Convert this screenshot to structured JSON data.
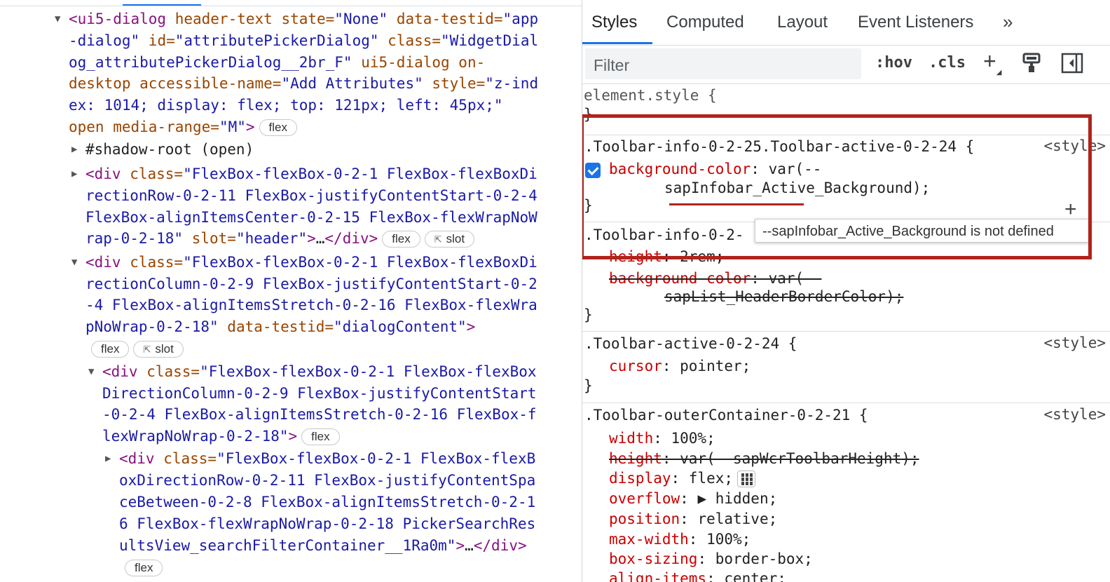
{
  "elements": {
    "lines": [
      {
        "segs": [
          [
            "tag",
            "<ui5-dialog "
          ],
          [
            "an",
            "header-text "
          ],
          [
            "an",
            "state="
          ],
          [
            "av",
            "\"None\" "
          ],
          [
            "an",
            "data-testid="
          ],
          [
            "av",
            "\"app"
          ]
        ]
      },
      {
        "segs": [
          [
            "av",
            "-dialog\" "
          ],
          [
            "an",
            "id="
          ],
          [
            "av",
            "\"attributePickerDialog\" "
          ],
          [
            "an",
            "class="
          ],
          [
            "av",
            "\"WidgetDial"
          ]
        ]
      },
      {
        "segs": [
          [
            "av",
            "og_attributePickerDialog__2br_F\" "
          ],
          [
            "an",
            "ui5-dialog on-"
          ]
        ]
      },
      {
        "segs": [
          [
            "an",
            "desktop accessible-name="
          ],
          [
            "av",
            "\"Add Attributes\" "
          ],
          [
            "an",
            "style="
          ],
          [
            "av",
            "\"z-ind"
          ]
        ]
      },
      {
        "segs": [
          [
            "av",
            "ex: 1014; display: flex; top: 121px; left: 45px;\""
          ]
        ]
      },
      {
        "segs": [
          [
            "an",
            "open media-range="
          ],
          [
            "av",
            "\"M\""
          ],
          [
            "tag",
            ">"
          ]
        ]
      },
      {
        "segs": [
          [
            "tx",
            "#shadow-root (open)"
          ]
        ]
      },
      {
        "segs": [
          [
            "tag",
            "<div "
          ],
          [
            "an",
            "class="
          ],
          [
            "av",
            "\"FlexBox-flexBox-0-2-1 FlexBox-flexBoxDi"
          ]
        ]
      },
      {
        "segs": [
          [
            "av",
            "rectionRow-0-2-11 FlexBox-justifyContentStart-0-2-4"
          ]
        ]
      },
      {
        "segs": [
          [
            "av",
            "FlexBox-alignItemsCenter-0-2-15 FlexBox-flexWrapNoW"
          ]
        ]
      },
      {
        "segs": [
          [
            "av",
            "rap-0-2-18\" "
          ],
          [
            "an",
            "slot="
          ],
          [
            "av",
            "\"header\""
          ],
          [
            "tag",
            ">"
          ],
          [
            "tx",
            "…"
          ],
          [
            "tag",
            "</div>"
          ]
        ]
      },
      {
        "segs": [
          [
            "tag",
            "<div "
          ],
          [
            "an",
            "class="
          ],
          [
            "av",
            "\"FlexBox-flexBox-0-2-1 FlexBox-flexBoxDi"
          ]
        ]
      },
      {
        "segs": [
          [
            "av",
            "rectionColumn-0-2-9 FlexBox-justifyContentStart-0-2"
          ]
        ]
      },
      {
        "segs": [
          [
            "av",
            "-4 FlexBox-alignItemsStretch-0-2-16 FlexBox-flexWra"
          ]
        ]
      },
      {
        "segs": [
          [
            "av",
            "pNoWrap-0-2-18\" "
          ],
          [
            "an",
            "data-testid="
          ],
          [
            "av",
            "\"dialogContent\""
          ],
          [
            "tag",
            ">"
          ]
        ]
      },
      {
        "segs": []
      },
      {
        "segs": [
          [
            "tag",
            "<div "
          ],
          [
            "an",
            "class="
          ],
          [
            "av",
            "\"FlexBox-flexBox-0-2-1 FlexBox-flexBox"
          ]
        ]
      },
      {
        "segs": [
          [
            "av",
            "DirectionColumn-0-2-9 FlexBox-justifyContentStart"
          ]
        ]
      },
      {
        "segs": [
          [
            "av",
            "-0-2-4 FlexBox-alignItemsStretch-0-2-16 FlexBox-f"
          ]
        ]
      },
      {
        "segs": [
          [
            "av",
            "lexWrapNoWrap-0-2-18\""
          ],
          [
            "tag",
            ">"
          ]
        ]
      },
      {
        "segs": [
          [
            "tag",
            "<div "
          ],
          [
            "an",
            "class="
          ],
          [
            "av",
            "\"FlexBox-flexBox-0-2-1 FlexBox-flexB"
          ]
        ]
      },
      {
        "segs": [
          [
            "av",
            "oxDirectionRow-0-2-11 FlexBox-justifyContentSpa"
          ]
        ]
      },
      {
        "segs": [
          [
            "av",
            "ceBetween-0-2-8 FlexBox-alignItemsStretch-0-2-1"
          ]
        ]
      },
      {
        "segs": [
          [
            "av",
            "6 FlexBox-flexWrapNoWrap-0-2-18 PickerSearchRes"
          ]
        ]
      },
      {
        "segs": [
          [
            "av",
            "ultsView_searchFilterContainer__1Ra0m\""
          ],
          [
            "tag",
            ">"
          ],
          [
            "tx",
            "…"
          ],
          [
            "tag",
            "</div>"
          ]
        ]
      },
      {
        "segs": []
      }
    ],
    "badges": {
      "flex": "flex",
      "slot": "slot"
    },
    "triangles": {
      "expanded": "▼",
      "collapsed": "▶"
    }
  },
  "styles": {
    "tabs": [
      "Styles",
      "Computed",
      "Layout",
      "Event Listeners",
      "»"
    ],
    "filter_placeholder": "Filter",
    "hov": ":hov",
    "cls": ".cls",
    "plus": "+",
    "element_style": "element.style {",
    "brace_close": "}",
    "source": "<style>",
    "rule1_selector": ".Toolbar-info-0-2-25.Toolbar-active-0-2-24 {",
    "rule1_prop": "background-color",
    "rule1_val_a": ": var(--",
    "rule1_val_b": "sapInfobar_Active_Background);",
    "rule2_selector": ".Toolbar-info-0-2-",
    "rule2_p1": "height",
    "rule2_v1": ": 2rem;",
    "rule2_p2": "background-color",
    "rule2_v2a": ": var(--",
    "rule2_v2b": "sapList_HeaderBorderColor);",
    "tooltip": "--sapInfobar_Active_Background is not defined",
    "rule3_selector": ".Toolbar-active-0-2-24 {",
    "rule3_prop": "cursor",
    "rule3_val": ": pointer;",
    "rule4_selector": ".Toolbar-outerContainer-0-2-21 {",
    "rule4_props": [
      {
        "p": "width",
        "v": ": 100%;",
        "strike": false
      },
      {
        "p": "height",
        "v": ": var(--sapWcrToolbarHeight);",
        "strike": true
      },
      {
        "p": "display",
        "v": ": flex;",
        "strike": false
      },
      {
        "p": "overflow",
        "v": ": ▶ hidden;",
        "strike": false
      },
      {
        "p": "position",
        "v": ": relative;",
        "strike": false
      },
      {
        "p": "max-width",
        "v": ": 100%;",
        "strike": false
      },
      {
        "p": "box-sizing",
        "v": ": border-box;",
        "strike": false
      },
      {
        "p": "align-items",
        "v": ": center;",
        "strike": false
      }
    ]
  }
}
